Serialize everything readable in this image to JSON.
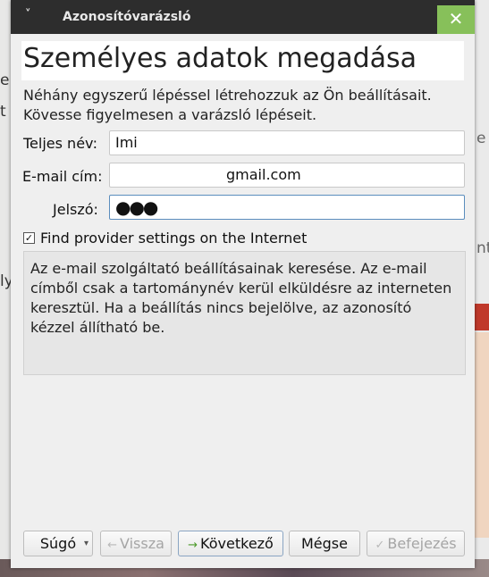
{
  "background": {
    "left_fragments": [
      "e",
      "t",
      "ly"
    ],
    "right_fragments": [
      "e",
      "nt"
    ]
  },
  "dialog": {
    "title": "Azonosítóvarázsló",
    "close_glyph": "✕",
    "menu_glyph": "˅",
    "heading": "Személyes adatok megadása",
    "intro_line1": "Néhány egyszerű lépéssel létrehozzuk az Ön beállításait.",
    "intro_line2": "Kövesse figyelmesen a varázsló lépéseit.",
    "fields": {
      "name_label": "Teljes név:",
      "name_value": "Imi",
      "email_label": "E-mail cím:",
      "email_value": "gmail.com",
      "password_label": "Jelszó:",
      "password_value": "●●●"
    },
    "checkbox": {
      "checked": true,
      "label": "Find provider settings on the Internet"
    },
    "info_text": "Az e-mail szolgáltató beállításainak keresése. Az e-mail címből csak a tartománynév kerül elküldésre az interneten keresztül. Ha a beállítás nincs bejelölve, az azonosító kézzel állítható be.",
    "buttons": {
      "help": "Súgó",
      "back": "Vissza",
      "next": "Következő",
      "cancel": "Mégse",
      "finish": "Befejezés"
    }
  }
}
